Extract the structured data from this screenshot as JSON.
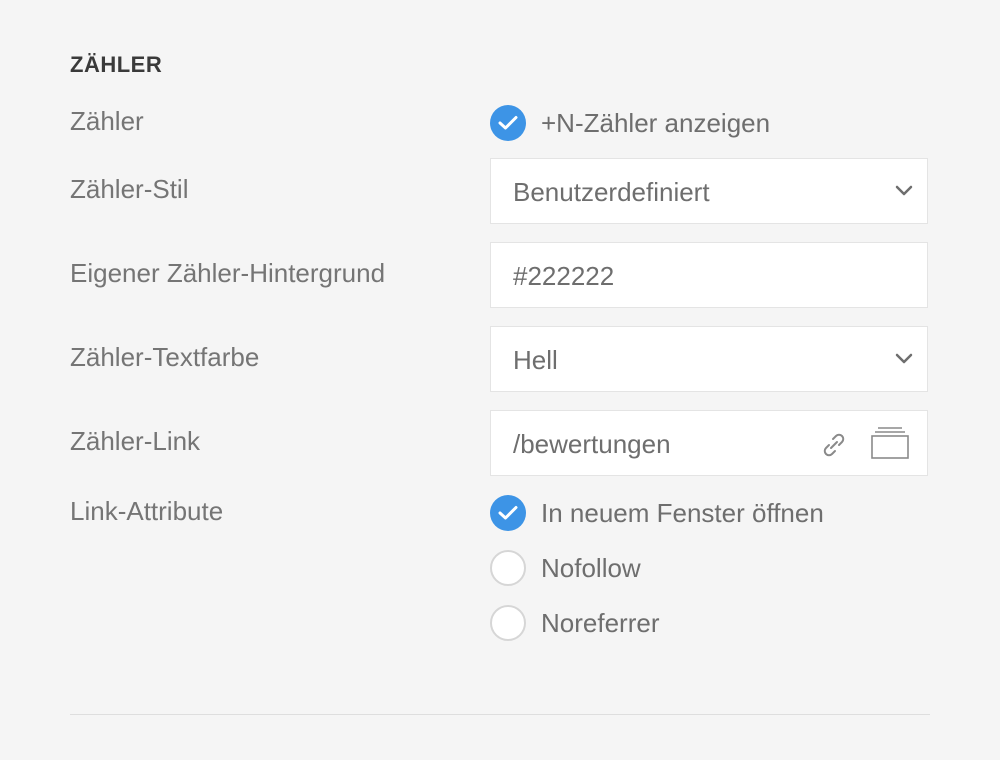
{
  "section": {
    "title": "ZÄHLER"
  },
  "counter": {
    "label": "Zähler",
    "checkbox_label": "+N-Zähler anzeigen",
    "checked": true
  },
  "counter_style": {
    "label": "Zähler-Stil",
    "value": "Benutzerdefiniert"
  },
  "counter_background": {
    "label": "Eigener Zähler-Hintergrund",
    "value": "#222222"
  },
  "counter_text_color": {
    "label": "Zähler-Textfarbe",
    "value": "Hell"
  },
  "counter_link": {
    "label": "Zähler-Link",
    "value": "/bewertungen",
    "icons": [
      "link-icon",
      "media-library-icon"
    ]
  },
  "link_attributes": {
    "label": "Link-Attribute",
    "options": [
      {
        "label": "In neuem Fenster öffnen",
        "checked": true
      },
      {
        "label": "Nofollow",
        "checked": false
      },
      {
        "label": "Noreferrer",
        "checked": false
      }
    ]
  },
  "colors": {
    "accent": "#3d94e6",
    "background": "#f5f5f5",
    "text": "#757575",
    "heading": "#3a3a3a"
  }
}
